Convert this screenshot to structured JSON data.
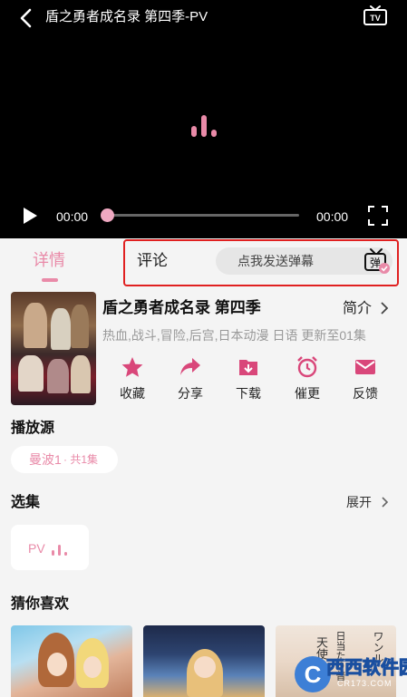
{
  "player": {
    "title": "盾之勇者成名录 第四季-PV",
    "current_time": "00:00",
    "total_time": "00:00",
    "progress_fraction": 0.0,
    "icons": {
      "back": "back-arrow-icon",
      "cast": "tv-cast-icon",
      "loading": "loading-bars-icon",
      "play": "play-icon",
      "fullscreen": "fullscreen-icon"
    }
  },
  "tabs": {
    "detail": "详情",
    "comment": "评论",
    "danmaku_placeholder": "点我发送弹幕",
    "danmaku_icon_text": "弹"
  },
  "anime": {
    "title": "盾之勇者成名录 第四季",
    "intro_label": "简介",
    "tags": "热血,战斗,冒险,后宫,日本动漫 日语 更新至01集"
  },
  "actions": [
    {
      "label": "收藏",
      "icon": "star-icon"
    },
    {
      "label": "分享",
      "icon": "share-icon"
    },
    {
      "label": "下载",
      "icon": "download-icon"
    },
    {
      "label": "催更",
      "icon": "alarm-clock-icon"
    },
    {
      "label": "反馈",
      "icon": "mail-icon"
    }
  ],
  "sources": {
    "title": "播放源",
    "selected_name": "曼波1",
    "selected_count": "· 共1集"
  },
  "episodes": {
    "title": "选集",
    "expand_label": "展开",
    "items": [
      {
        "label": "PV"
      }
    ]
  },
  "recommend": {
    "title": "猜你喜欢",
    "item3_text_a": "ワンル",
    "item3_text_b": "日当たり普",
    "item3_text_c": "天使つ"
  },
  "watermark": {
    "logo_letter": "C",
    "text": "西西软件园",
    "url": "CR173.COM"
  },
  "colors": {
    "accent_pink": "#e98aa8",
    "highlight_red": "#e02020",
    "background": "#f4f4f4"
  }
}
